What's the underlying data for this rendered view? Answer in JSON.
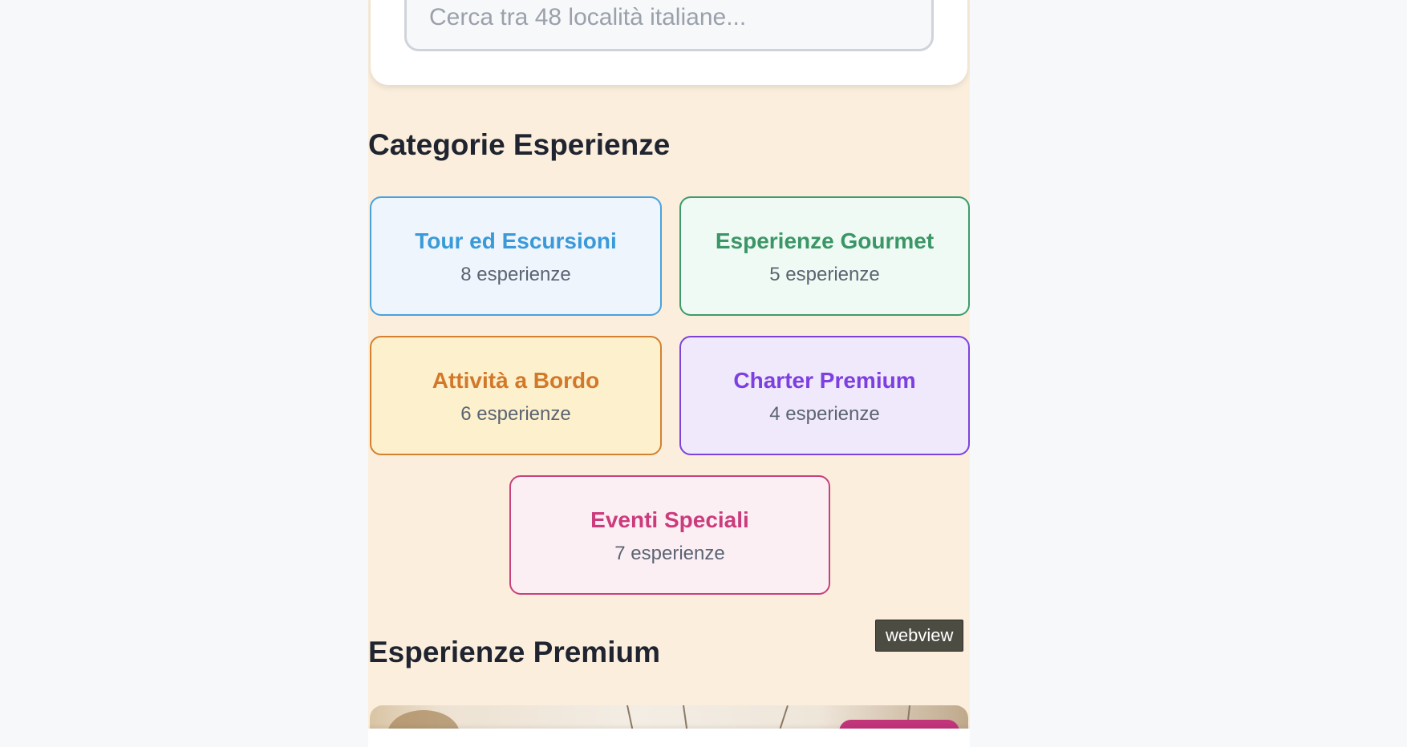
{
  "search": {
    "placeholder": "Cerca tra 48 località italiane..."
  },
  "categories_section": {
    "title": "Categorie Esperienze",
    "items": [
      {
        "name": "Tour ed Escursioni",
        "count": "8 esperienze",
        "accent": "#3a9ad9",
        "background": "#eef5fd",
        "border": "#4aa2dc"
      },
      {
        "name": "Esperienze Gourmet",
        "count": "5 esperienze",
        "accent": "#3b9667",
        "background": "#eefaf3",
        "border": "#3f9b6b"
      },
      {
        "name": "Attività a Bordo",
        "count": "6 esperienze",
        "accent": "#d3782a",
        "background": "#fcf1cc",
        "border": "#d3802f"
      },
      {
        "name": "Charter Premium",
        "count": "4 esperienze",
        "accent": "#7c3fe0",
        "background": "#f0e8fb",
        "border": "#7c43dc"
      },
      {
        "name": "Eventi Speciali",
        "count": "7 esperienze",
        "accent": "#cc3b7b",
        "background": "#fbeff4",
        "border": "#c7417c"
      }
    ]
  },
  "tooltip": {
    "text": "webview"
  },
  "premium_section": {
    "title": "Esperienze Premium"
  },
  "colors": {
    "page_background": "#f7f8fa",
    "content_background": "#fbeedc",
    "heading_text": "#1f2430",
    "muted_text": "#5b6472",
    "premium_badge": "#c2357a"
  }
}
